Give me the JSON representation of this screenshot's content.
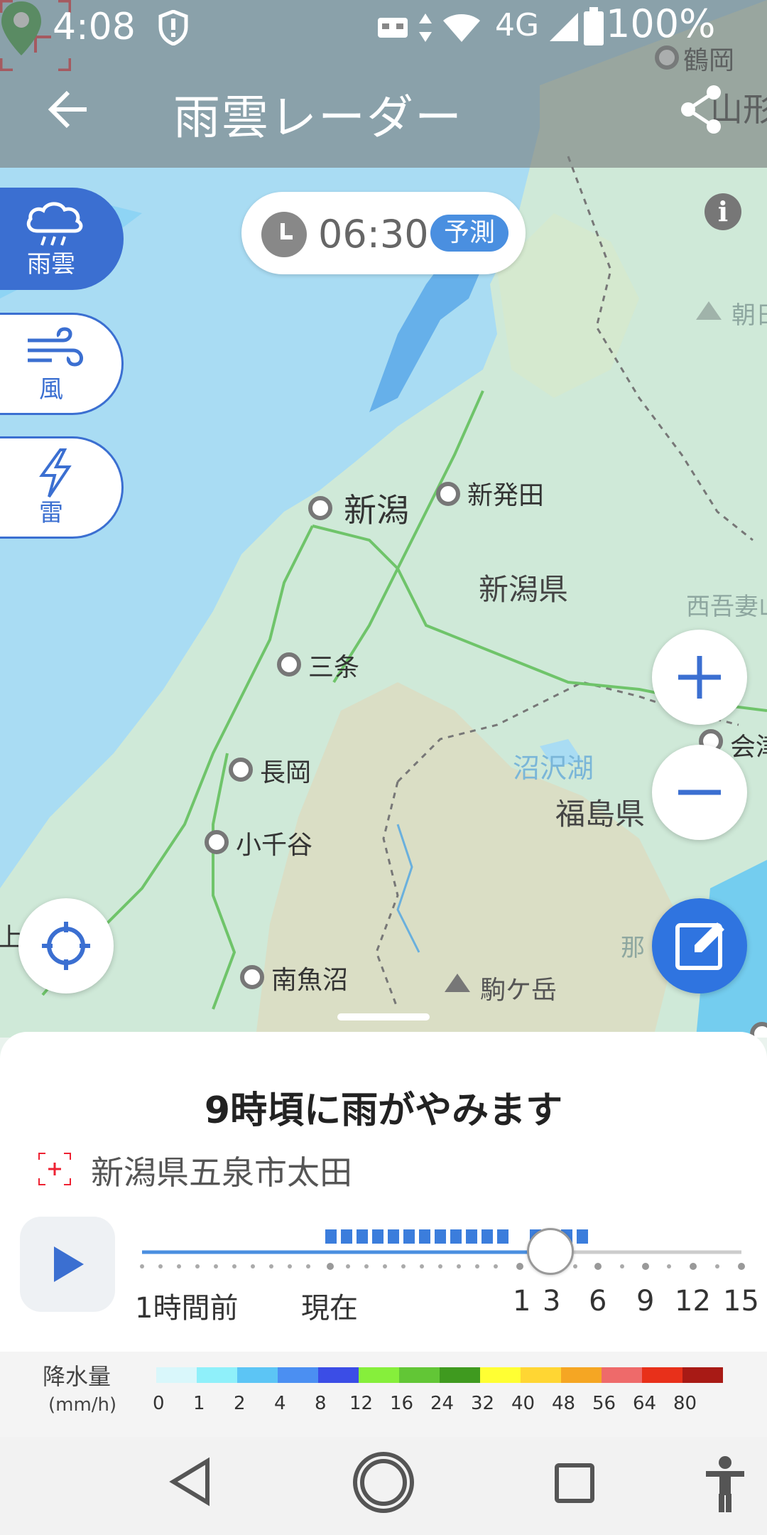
{
  "status_bar": {
    "time": "4:08",
    "network": "4G",
    "battery": "100%"
  },
  "header": {
    "title": "雨雲レーダー"
  },
  "layers": [
    {
      "label": "雨雲",
      "icon": "rain-cloud-icon",
      "active": true
    },
    {
      "label": "風",
      "icon": "wind-icon",
      "active": false
    },
    {
      "label": "雷",
      "icon": "lightning-icon",
      "active": false
    }
  ],
  "time_pill": {
    "time": "06:30",
    "badge": "予測"
  },
  "map": {
    "cities": [
      "鶴岡",
      "山形",
      "朝日",
      "新潟",
      "新発田",
      "新潟県",
      "西吾妻山",
      "三条",
      "会津",
      "沼沢湖",
      "長岡",
      "福島県",
      "小千谷",
      "南魚沼",
      "駒ケ岳",
      "那須",
      "上越"
    ],
    "labels": {
      "tsuruoka": "鶴岡",
      "yamagata": "山形",
      "asahi": "朝日",
      "niigata": "新潟",
      "shibata": "新発田",
      "niigata_pref": "新潟県",
      "nishiazuma": "西吾妻山",
      "sanjo": "三条",
      "aizu": "会津",
      "numazawa": "沼沢湖",
      "nagaoka": "長岡",
      "fukushima_pref": "福島県",
      "ojiya": "小千谷",
      "minamiuonuma": "南魚沼",
      "komagatake": "駒ケ岳",
      "nasu": "那",
      "joetsu": "上越"
    }
  },
  "sheet": {
    "title": "9時頃に雨がやみます",
    "location": "新潟県五泉市太田",
    "timeline_labels": [
      "1時間前",
      "現在",
      "1",
      "3",
      "6",
      "9",
      "12",
      "15"
    ],
    "slider_position": 0.57
  },
  "legend": {
    "title": "降水量",
    "unit": "(mm/h)",
    "values": [
      "0",
      "1",
      "2",
      "4",
      "8",
      "12",
      "16",
      "24",
      "32",
      "40",
      "48",
      "56",
      "64",
      "80"
    ],
    "colors": [
      "#d9f7fb",
      "#8ff0fa",
      "#5cc5f5",
      "#4b8ff2",
      "#3b4de6",
      "#86ef3b",
      "#62c636",
      "#3f9a1f",
      "#ffff33",
      "#ffd633",
      "#f5a623",
      "#ee6a6a",
      "#e8301a",
      "#a81a15"
    ]
  },
  "colors": {
    "accent": "#3b6fd1",
    "button_blue": "#2f74e0",
    "pin_green": "#2aa23c"
  }
}
